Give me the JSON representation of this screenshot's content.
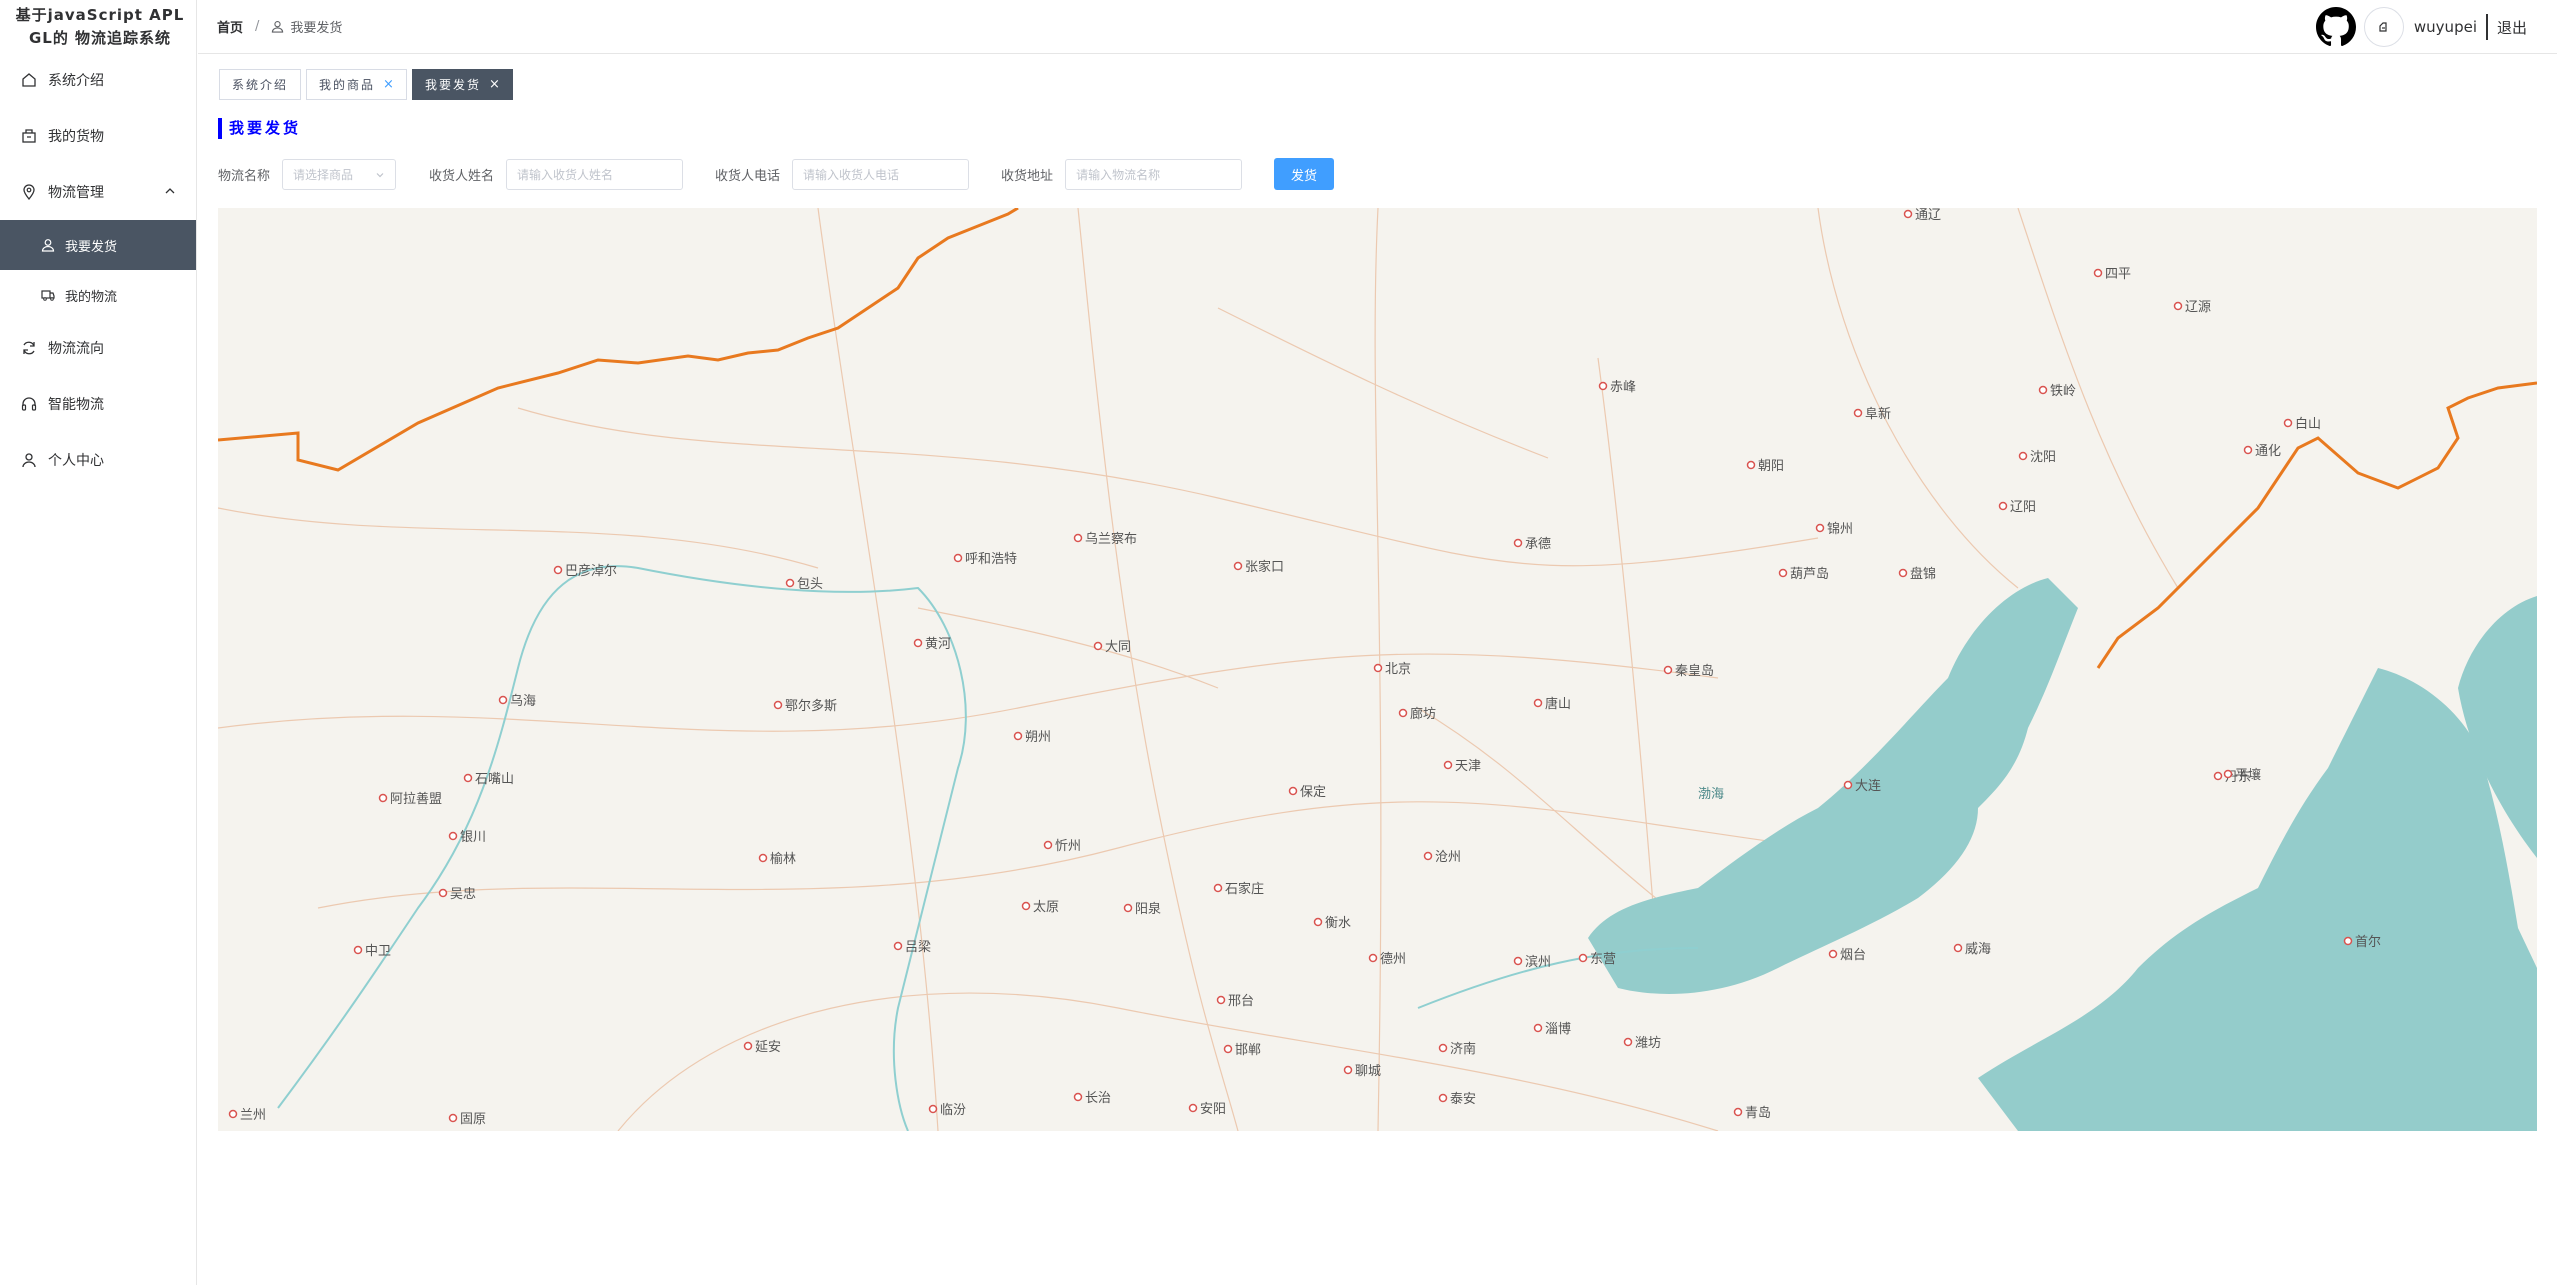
{
  "app": {
    "title_line1": "基于javaScript APL",
    "title_line2": "GL的 物流追踪系统"
  },
  "sidebar": {
    "items": [
      {
        "label": "系统介绍",
        "icon": "home-icon"
      },
      {
        "label": "我的货物",
        "icon": "box-icon"
      },
      {
        "label": "物流管理",
        "icon": "location-icon",
        "expanded": true,
        "children": [
          {
            "label": "我要发货",
            "icon": "user-icon",
            "active": true
          },
          {
            "label": "我的物流",
            "icon": "truck-icon"
          }
        ]
      },
      {
        "label": "物流流向",
        "icon": "refresh-icon"
      },
      {
        "label": "智能物流",
        "icon": "headset-icon"
      },
      {
        "label": "个人中心",
        "icon": "user-icon"
      }
    ]
  },
  "header": {
    "breadcrumb_home": "首页",
    "breadcrumb_sep": "/",
    "breadcrumb_current": "我要发货",
    "username": "wuyupei",
    "logout": "退出"
  },
  "tabs": [
    {
      "label": "系统介绍",
      "closable": false,
      "active": false
    },
    {
      "label": "我的商品",
      "closable": true,
      "active": false
    },
    {
      "label": "我要发货",
      "closable": true,
      "active": true
    }
  ],
  "tab_close_glyph": "×",
  "section_title": "我要发货",
  "form": {
    "goods_label": "物流名称",
    "goods_placeholder": "请选择商品",
    "receiver_name_label": "收货人姓名",
    "receiver_name_placeholder": "请输入收货人姓名",
    "receiver_phone_label": "收货人电话",
    "receiver_phone_placeholder": "请输入收货人电话",
    "address_label": "收货地址",
    "address_placeholder": "请输入物流名称",
    "submit_label": "发货"
  },
  "map": {
    "colors": {
      "land": "#f5f3ee",
      "water": "#94cccb",
      "border": "#e8791f",
      "road": "#ecc9b0",
      "river": "#8fcfd0"
    },
    "water_labels": [
      "渤海"
    ],
    "cities": [
      "通辽",
      "四平",
      "辽源",
      "赤峰",
      "阜新",
      "铁岭",
      "白山",
      "通化",
      "沈阳",
      "朝阳",
      "辽阳",
      "锦州",
      "葫芦岛",
      "盘锦",
      "承德",
      "乌兰察布",
      "呼和浩特",
      "张家口",
      "巴彦淖尔",
      "包头",
      "黄河",
      "大同",
      "北京",
      "秦皇岛",
      "廊坊",
      "唐山",
      "乌海",
      "鄂尔多斯",
      "朔州",
      "天津",
      "石嘴山",
      "阿拉善盟",
      "大连",
      "保定",
      "丹东",
      "平壤",
      "银川",
      "忻州",
      "榆林",
      "沧州",
      "吴忠",
      "石家庄",
      "太原",
      "阳泉",
      "衡水",
      "中卫",
      "吕梁",
      "德州",
      "滨州",
      "东营",
      "烟台",
      "威海",
      "首尔",
      "邢台",
      "延安",
      "邯郸",
      "济南",
      "淄博",
      "潍坊",
      "聊城",
      "兰州",
      "固原",
      "临汾",
      "长治",
      "安阳",
      "泰安",
      "青岛"
    ]
  }
}
